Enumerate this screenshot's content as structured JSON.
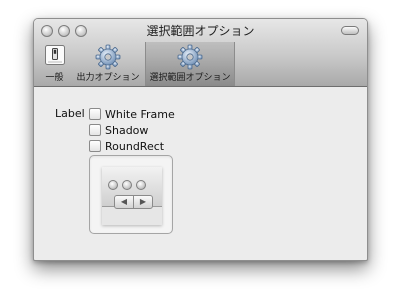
{
  "window": {
    "title": "選択範囲オプション"
  },
  "toolbar": {
    "items": [
      {
        "label": "一般",
        "icon": "switch-icon",
        "selected": false
      },
      {
        "label": "出力オプション",
        "icon": "gear-icon",
        "selected": false
      },
      {
        "label": "選択範囲オプション",
        "icon": "gear-icon",
        "selected": true
      }
    ]
  },
  "options": {
    "label": "Label",
    "checkboxes": [
      {
        "label": "White Frame",
        "checked": false
      },
      {
        "label": "Shadow",
        "checked": false
      },
      {
        "label": "RoundRect",
        "checked": false
      }
    ]
  },
  "preview": {
    "back_glyph": "◀",
    "forward_glyph": "▶"
  },
  "colors": {
    "window_bg": "#ececec",
    "toolbar_dark": "#a9a9a9",
    "toolbar_light": "#e7e7e7"
  }
}
